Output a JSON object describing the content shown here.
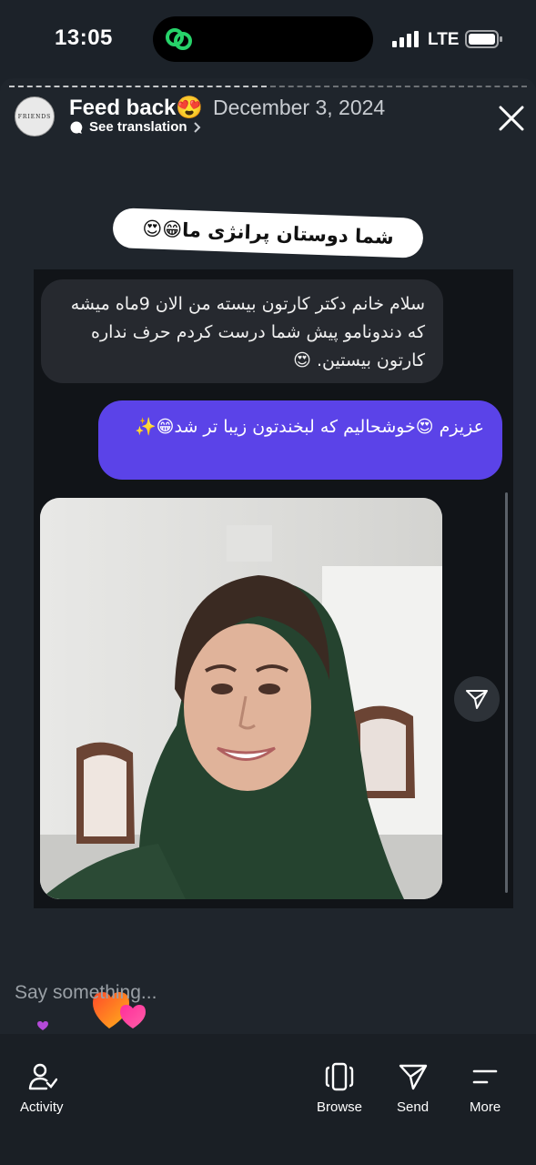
{
  "status_bar": {
    "time": "13:05",
    "network": "LTE"
  },
  "header": {
    "avatar_text": "FRIENDS",
    "username": "Feed back😍",
    "date": "December 3, 2024",
    "translate": "See translation"
  },
  "sticker": {
    "text": "شما دوستان پرانژی ما😁😍"
  },
  "chat": {
    "incoming": "سلام خانم دکتر کارتون بیسته من الان 9ماه میشه که دندونامو پیش شما درست کردم حرف نداره کارتون بیستین. 😍",
    "outgoing": "عزیزم 😍خوشحالیم که لبخندتون زیبا تر شد😁✨"
  },
  "reply": {
    "placeholder": "Say something..."
  },
  "nav": [
    {
      "icon": "activity-icon",
      "label": "Activity"
    },
    {
      "icon": "browse-icon",
      "label": "Browse"
    },
    {
      "icon": "send-icon",
      "label": "Send"
    },
    {
      "icon": "more-icon",
      "label": "More"
    }
  ],
  "colors": {
    "background": "#1c2229",
    "outgoing_bubble": "#5b43e8",
    "incoming_bubble": "#26292f"
  }
}
